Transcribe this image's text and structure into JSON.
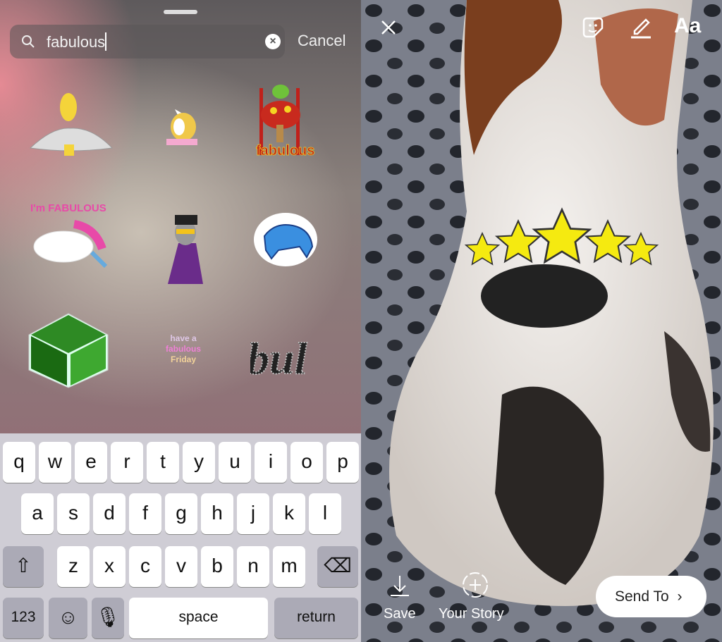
{
  "search": {
    "query": "fabulous",
    "cancel_label": "Cancel",
    "icon": "search-icon",
    "clear_icon": "clear-icon"
  },
  "stickers": [
    {
      "name": "homer-sticker"
    },
    {
      "name": "unicorn-banner-sticker"
    },
    {
      "name": "frog-mushroom-sticker",
      "text": "fabulous"
    },
    {
      "name": "im-fabulous-unicorn-sticker",
      "text": "I'm FABULOUS"
    },
    {
      "name": "troll-character-sticker"
    },
    {
      "name": "blue-horse-sticker"
    },
    {
      "name": "photo-cube-sticker"
    },
    {
      "name": "fabulous-friday-sticker",
      "text": "have a fabulous Friday"
    },
    {
      "name": "glitter-fabulous-sticker",
      "text": "fabulous"
    }
  ],
  "keyboard": {
    "row1": [
      "q",
      "w",
      "e",
      "r",
      "t",
      "y",
      "u",
      "i",
      "o",
      "p"
    ],
    "row2": [
      "a",
      "s",
      "d",
      "f",
      "g",
      "h",
      "j",
      "k",
      "l"
    ],
    "row3": [
      "z",
      "x",
      "c",
      "v",
      "b",
      "n",
      "m"
    ],
    "numbers_label": "123",
    "space_label": "space",
    "return_label": "return"
  },
  "story": {
    "text_tool_label": "Aa",
    "save_label": "Save",
    "your_story_label": "Your Story",
    "send_to_label": "Send To",
    "sticker_placed": "five-stars-sticker",
    "star_color": "#f5ea10"
  }
}
